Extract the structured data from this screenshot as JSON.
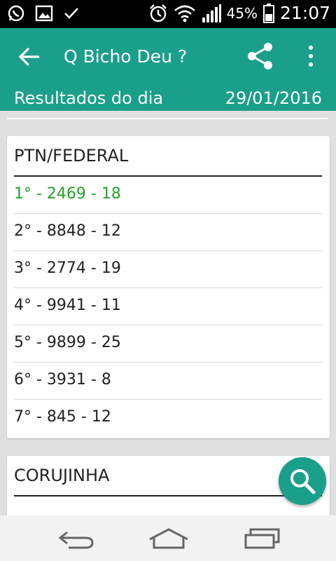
{
  "status_bar": {
    "icons_left": [
      "whatsapp-icon",
      "image-icon",
      "check-icon"
    ],
    "icons_right": [
      "alarm-icon",
      "wifi-icon",
      "signal-icon",
      "battery-icon"
    ],
    "battery": "45%",
    "time": "21:07"
  },
  "app_bar": {
    "title": "Q Bicho Deu ?",
    "subtitle": "Resultados do dia",
    "date": "29/01/2016",
    "color": "#1a9f8a"
  },
  "cards": [
    {
      "title": "PTN/FEDERAL",
      "results": [
        "1° - 2469 - 18",
        "2° - 8848 - 12",
        "3° - 2774 - 19",
        "4° - 9941 - 11",
        "5° - 9899 - 25",
        "6° - 3931 - 8",
        "7° - 845 - 12"
      ]
    },
    {
      "title": "CORUJINHA"
    }
  ],
  "highlight_color": "#25a22a"
}
